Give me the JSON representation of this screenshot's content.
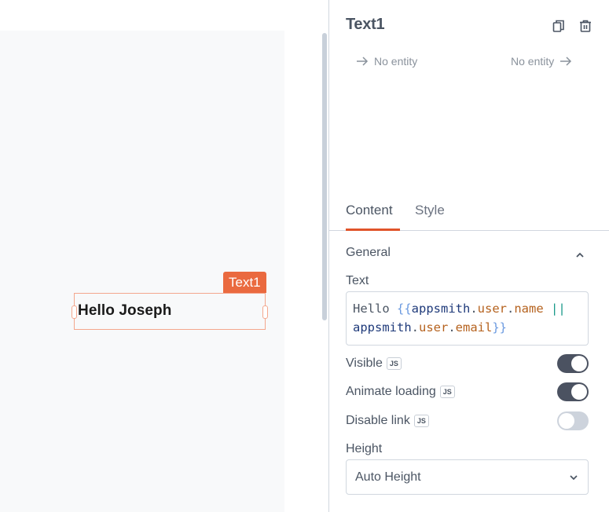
{
  "canvas": {
    "widget": {
      "tag_label": "Text1",
      "text": "Hello Joseph"
    }
  },
  "pane": {
    "title": "Text1",
    "actions": {
      "copy_icon": "copy-icon",
      "delete_icon": "trash-icon"
    },
    "entity_left": "No entity",
    "entity_right": "No entity",
    "tabs": [
      {
        "label": "Content",
        "active": true
      },
      {
        "label": "Style",
        "active": false
      }
    ],
    "section": {
      "title": "General",
      "expanded": true
    },
    "text_field": {
      "label": "Text",
      "value": "Hello {{appsmith.user.name || appsmith.user.email}}",
      "tokens_line1": [
        "Hello ",
        "{{",
        "appsmith",
        ".",
        "user",
        ".",
        "name",
        " ",
        "||"
      ],
      "tokens_line2": [
        "appsmith",
        ".",
        "user",
        ".",
        "email",
        "}}"
      ]
    },
    "toggles": [
      {
        "label": "Visible",
        "badge": "JS",
        "on": true
      },
      {
        "label": "Animate loading",
        "badge": "JS",
        "on": true
      },
      {
        "label": "Disable link",
        "badge": "JS",
        "on": false
      }
    ],
    "height_field": {
      "label": "Height",
      "value": "Auto Height"
    }
  },
  "colors": {
    "accent": "#e0542a",
    "widget_tag": "#ea6a3f",
    "toggle_on": "#4b5261",
    "toggle_off": "#cdd3dc"
  }
}
